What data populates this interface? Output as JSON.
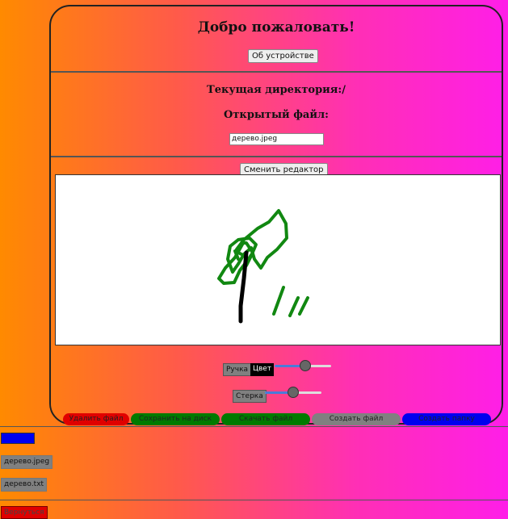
{
  "header": {
    "welcome": "Добро пожаловать!",
    "about_button": "Об устройстве"
  },
  "file_section": {
    "current_dir": "Текущая директория:/",
    "open_file_label": "Открытый файл:",
    "open_file_value": "дерево.jpeg"
  },
  "editor": {
    "switch_button": "Сменить редактор",
    "pen_label": "Ручка",
    "color_label": "Цвет",
    "pen_size_fraction": 0.56,
    "eraser_label": "Стерка",
    "eraser_size_fraction": 0.5,
    "drawing_colors": {
      "leaves": "#118811",
      "trunk": "#000000"
    }
  },
  "actions": [
    {
      "label": "Удалить файл",
      "color": "#e00000"
    },
    {
      "label": "Сохранить на диск",
      "color": "#007a00"
    },
    {
      "label": "Скачать файл",
      "color": "#007a00"
    },
    {
      "label": "Создать файл",
      "color": "#808080"
    },
    {
      "label": "Создать папку",
      "color": "#0000ee"
    }
  ],
  "sidebar": {
    "folder_button": "",
    "files": [
      "дерево.jpeg",
      "дерево.txt"
    ],
    "back_button": "Вернуться"
  }
}
